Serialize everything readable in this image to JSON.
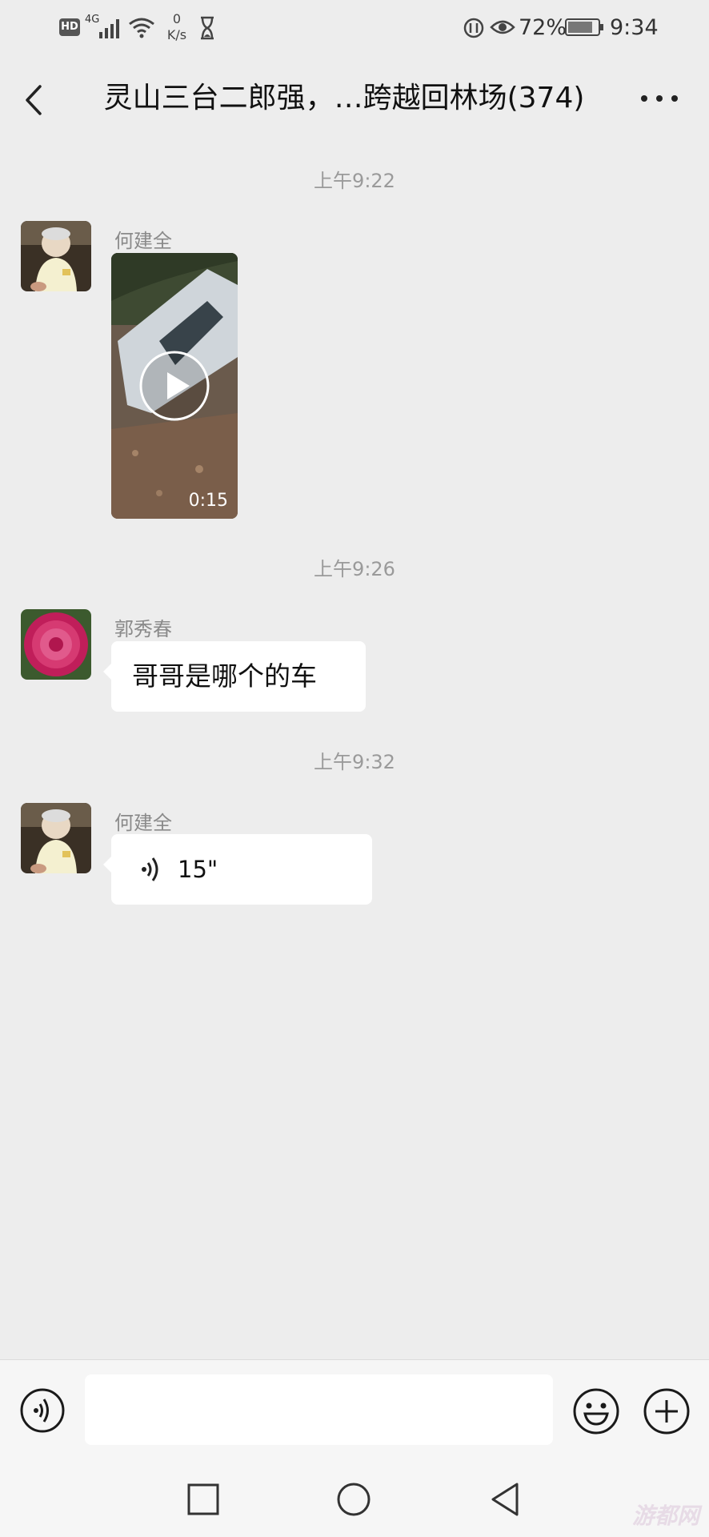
{
  "status_bar": {
    "network": "4G",
    "speed_value": "0",
    "speed_unit": "K/s",
    "battery": "72%",
    "time": "9:34"
  },
  "header": {
    "title": "灵山三台二郎强，…跨越回林场(374)"
  },
  "messages": [
    {
      "type": "timestamp",
      "text": "上午9:22"
    },
    {
      "type": "video",
      "sender": "何建全",
      "duration": "0:15"
    },
    {
      "type": "timestamp",
      "text": "上午9:26"
    },
    {
      "type": "text",
      "sender": "郭秀春",
      "text": "哥哥是哪个的车"
    },
    {
      "type": "timestamp",
      "text": "上午9:32"
    },
    {
      "type": "voice",
      "sender": "何建全",
      "duration": "15\""
    }
  ],
  "icons": {
    "back": "chevron-left-icon",
    "more": "more-dots-icon",
    "voice_toggle": "voice-icon",
    "emoji": "emoji-icon",
    "plus": "plus-icon",
    "nav_recent": "square-icon",
    "nav_home": "circle-icon",
    "nav_back": "triangle-back-icon"
  },
  "watermark": "游都网"
}
